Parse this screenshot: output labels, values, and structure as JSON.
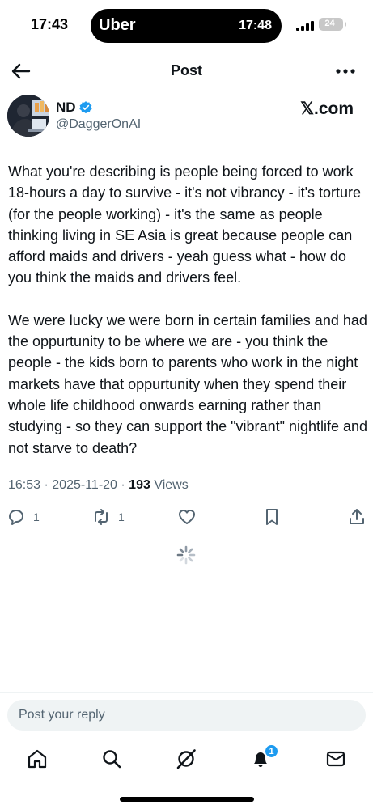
{
  "status_bar": {
    "time": "17:43",
    "island_brand": "Uber",
    "island_time": "17:48",
    "battery_level": "24",
    "battery_color": "#c8c8c8"
  },
  "header": {
    "title": "Post",
    "back_icon": "arrow-left-icon",
    "more_icon": "ellipsis-icon"
  },
  "post": {
    "author_name": "ND",
    "author_handle": "@DaggerOnAI",
    "verified": true,
    "watermark": "𝕏.com",
    "paragraphs": [
      "What you're describing is people being forced to work 18-hours a day to survive - it's not vibrancy - it's torture (for the people working) - it's the same as people thinking living in SE Asia is great because people can afford maids and drivers - yeah guess what - how do you think the maids and drivers feel.",
      "We were lucky we were born in certain families and had the oppurtunity to be where we are - you think the people - the kids born to parents who work in the night markets have that oppurtunity when they spend their whole life childhood onwards earning rather than studying - so they can support the \"vibrant\" nightlife and not starve to death?"
    ],
    "time": "16:53",
    "separator": "·",
    "date": "2025-11-20",
    "views_count": "193",
    "views_label": "Views",
    "actions": {
      "replies": "1",
      "reposts": "1"
    }
  },
  "reply": {
    "placeholder": "Post your reply"
  },
  "tabbar": {
    "notifications_badge": "1",
    "accent_color": "#1d9bf0"
  }
}
